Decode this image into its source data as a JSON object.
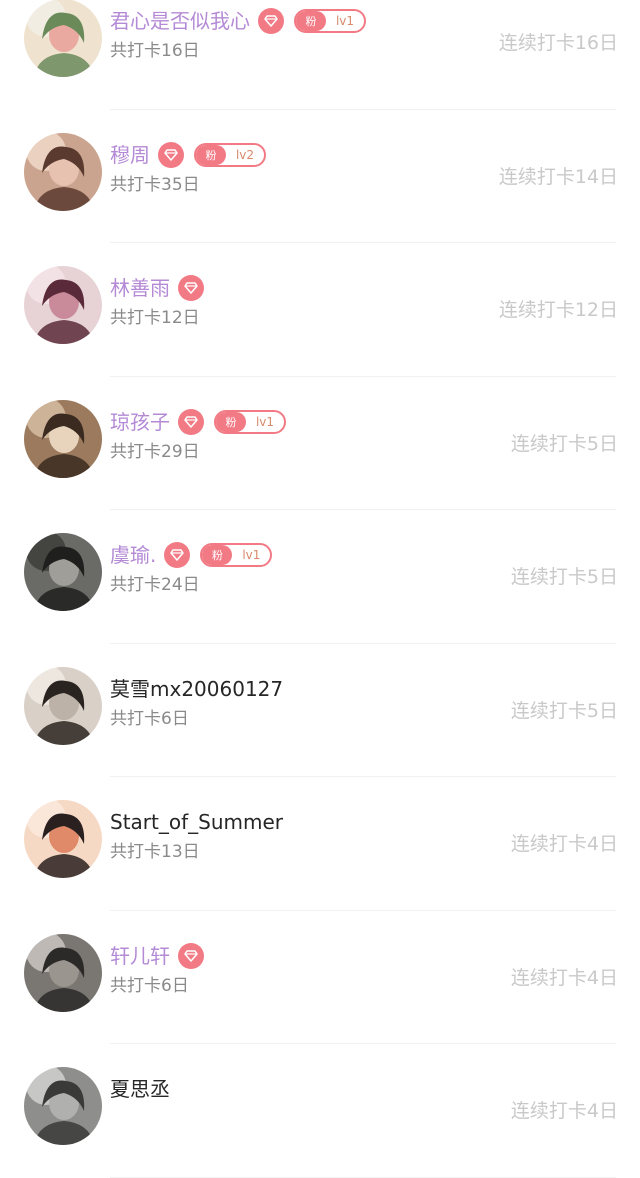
{
  "colors": {
    "vip_name": "#b48ad6",
    "plain_name": "#262626",
    "diamond": "#f27a85",
    "fan_badge": "#f27a85",
    "streak_text": "#c9c9c9",
    "sub_text": "#8a8a8a"
  },
  "users": [
    {
      "name": "君心是否似我心",
      "vip": true,
      "fan_label": "粉",
      "fan_level": "lv1",
      "total": "共打卡16日",
      "streak": "连续打卡16日",
      "avatar_icon": "avatar-moomin-icon"
    },
    {
      "name": "穆周",
      "vip": true,
      "fan_label": "粉",
      "fan_level": "lv2",
      "total": "共打卡35日",
      "streak": "连续打卡14日",
      "avatar_icon": "avatar-photo-icon"
    },
    {
      "name": "林善雨",
      "vip": true,
      "fan_label": "",
      "fan_level": "",
      "total": "共打卡12日",
      "streak": "连续打卡12日",
      "avatar_icon": "avatar-photo-icon"
    },
    {
      "name": "琼孩子",
      "vip": true,
      "fan_label": "粉",
      "fan_level": "lv1",
      "total": "共打卡29日",
      "streak": "连续打卡5日",
      "avatar_icon": "avatar-photo-icon"
    },
    {
      "name": "虞瑜.",
      "vip": true,
      "fan_label": "粉",
      "fan_level": "lv1",
      "total": "共打卡24日",
      "streak": "连续打卡5日",
      "avatar_icon": "avatar-photo-icon"
    },
    {
      "name": "莫雪mx20060127",
      "vip": false,
      "fan_label": "",
      "fan_level": "",
      "total": "共打卡6日",
      "streak": "连续打卡5日",
      "avatar_icon": "avatar-photo-icon"
    },
    {
      "name": "Start_of_Summer",
      "vip": false,
      "fan_label": "",
      "fan_level": "",
      "total": "共打卡13日",
      "streak": "连续打卡4日",
      "avatar_icon": "avatar-cartoon-icon"
    },
    {
      "name": "轩儿轩",
      "vip": true,
      "fan_label": "",
      "fan_level": "",
      "total": "共打卡6日",
      "streak": "连续打卡4日",
      "avatar_icon": "avatar-photo-icon"
    },
    {
      "name": "夏思丞",
      "vip": false,
      "fan_label": "",
      "fan_level": "",
      "total": "",
      "streak": "连续打卡4日",
      "avatar_icon": "avatar-photo-icon"
    }
  ]
}
